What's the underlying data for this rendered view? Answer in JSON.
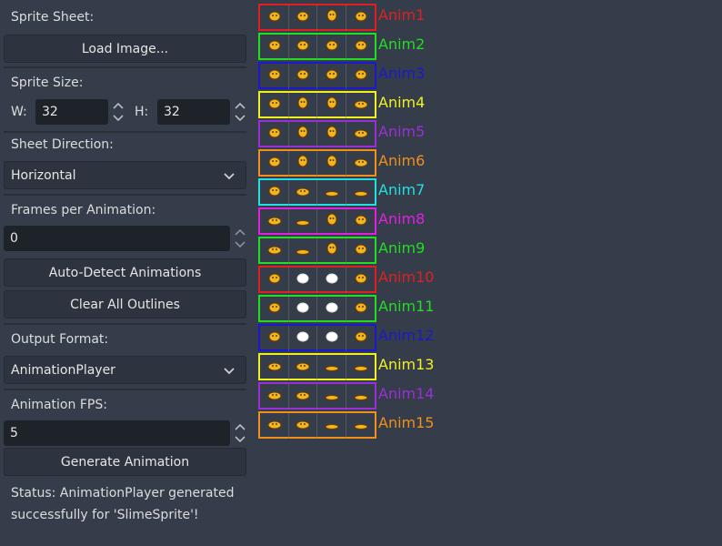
{
  "panel": {
    "sprite_sheet_label": "Sprite Sheet:",
    "load_button": "Load Image...",
    "sprite_size_label": "Sprite Size:",
    "w_label": "W:",
    "w_value": "32",
    "h_label": "H:",
    "h_value": "32",
    "sheet_direction_label": "Sheet Direction:",
    "sheet_direction_value": "Horizontal",
    "frames_label": "Frames per Animation:",
    "frames_value": "0",
    "auto_detect_button": "Auto-Detect Animations",
    "clear_outlines_button": "Clear All Outlines",
    "output_format_label": "Output Format:",
    "output_format_value": "AnimationPlayer",
    "fps_label": "Animation FPS:",
    "fps_value": "5",
    "generate_button": "Generate Animation",
    "status_text": "Status: AnimationPlayer generated successfully for 'SlimeSprite'!"
  },
  "animations": [
    {
      "label": "Anim1",
      "color": "#e02020"
    },
    {
      "label": "Anim2",
      "color": "#22dd22"
    },
    {
      "label": "Anim3",
      "color": "#1a1acc"
    },
    {
      "label": "Anim4",
      "color": "#f0f020"
    },
    {
      "label": "Anim5",
      "color": "#9a2fd6"
    },
    {
      "label": "Anim6",
      "color": "#f0901a"
    },
    {
      "label": "Anim7",
      "color": "#22e0e0"
    },
    {
      "label": "Anim8",
      "color": "#e020e0"
    },
    {
      "label": "Anim9",
      "color": "#22dd22"
    },
    {
      "label": "Anim10",
      "color": "#e02020"
    },
    {
      "label": "Anim11",
      "color": "#22dd22"
    },
    {
      "label": "Anim12",
      "color": "#1a1acc"
    },
    {
      "label": "Anim13",
      "color": "#f0f020"
    },
    {
      "label": "Anim14",
      "color": "#9a2fd6"
    },
    {
      "label": "Anim15",
      "color": "#f0901a"
    }
  ],
  "frames_per_row": 4
}
